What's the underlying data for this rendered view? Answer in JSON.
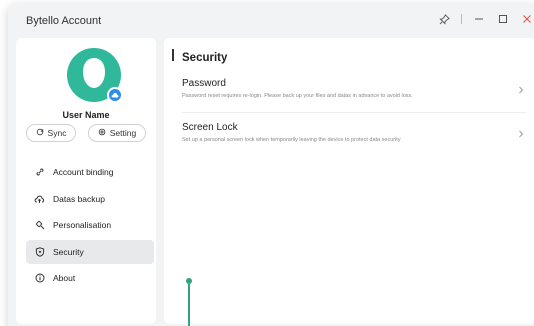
{
  "window": {
    "title": "Bytello Account",
    "controls": {
      "pin_icon": "pin-icon",
      "minimize_icon": "minimize-icon",
      "maximize_icon": "maximize-icon",
      "close_icon": "close-icon"
    }
  },
  "profile": {
    "user_name": "User Name",
    "avatar_color": "#2fb89a",
    "badge_color": "#2d8cf0",
    "sync_label": "Sync",
    "setting_label": "Setting"
  },
  "sidebar": {
    "items": [
      {
        "label": "Account binding",
        "icon": "link-icon",
        "active": false
      },
      {
        "label": "Datas backup",
        "icon": "cloud-upload-icon",
        "active": false
      },
      {
        "label": "Personalisation",
        "icon": "gear-brush-icon",
        "active": false
      },
      {
        "label": "Security",
        "icon": "shield-icon",
        "active": true
      },
      {
        "label": "About",
        "icon": "info-icon",
        "active": false
      }
    ]
  },
  "content": {
    "section_title": "Security",
    "rows": [
      {
        "title": "Password",
        "description": "Password reset requires re-login. Please back up your files and datas in advance to avoid loss."
      },
      {
        "title": "Screen Lock",
        "description": "Set up a personal screen lock when temporarily leaving the device to protect data security"
      }
    ]
  },
  "colors": {
    "accent_green": "#2fa37d",
    "close_red": "#e5533c"
  }
}
